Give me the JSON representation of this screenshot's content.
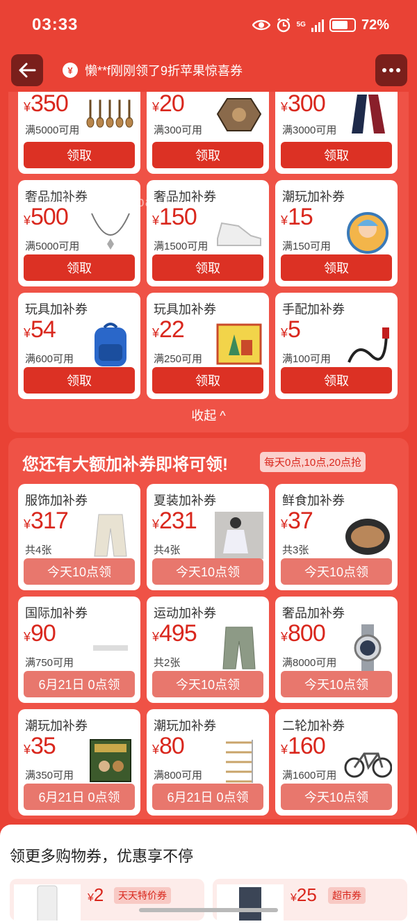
{
  "status": {
    "time": "03:33",
    "network": "5G",
    "battery": "72%",
    "battery_level": 0.72
  },
  "header": {
    "notice": "懒**f刚刚领了9折苹果惊喜券",
    "notice_icon": "¥"
  },
  "watermark": "新浪团-new.xianbao.fun",
  "claim_section": {
    "coupons": [
      {
        "label": "",
        "amount": "350",
        "condition": "满5000可用",
        "button": "领取",
        "icon": "guitars-image"
      },
      {
        "label": "",
        "amount": "20",
        "condition": "满300可用",
        "button": "领取",
        "icon": "concertina-image"
      },
      {
        "label": "",
        "amount": "300",
        "condition": "满3000可用",
        "button": "领取",
        "icon": "scarf-image"
      },
      {
        "label": "奢品加补券",
        "amount": "500",
        "condition": "满5000可用",
        "button": "领取",
        "icon": "necklace-image"
      },
      {
        "label": "奢品加补券",
        "amount": "150",
        "condition": "满1500可用",
        "button": "领取",
        "icon": "sneaker-image"
      },
      {
        "label": "潮玩加补券",
        "amount": "15",
        "condition": "满150可用",
        "button": "领取",
        "icon": "badge-image"
      },
      {
        "label": "玩具加补券",
        "amount": "54",
        "condition": "满600可用",
        "button": "领取",
        "icon": "backpack-image"
      },
      {
        "label": "玩具加补券",
        "amount": "22",
        "condition": "满250可用",
        "button": "领取",
        "icon": "puzzle-box-image"
      },
      {
        "label": "手配加补券",
        "amount": "5",
        "condition": "满100可用",
        "button": "领取",
        "icon": "cable-image"
      }
    ],
    "collapse_label": "收起 ^"
  },
  "upcoming_section": {
    "title": "您还有大额加补券即将可领!",
    "tag": "每天0点,10点,20点抢",
    "coupons": [
      {
        "label": "服饰加补券",
        "amount": "317",
        "condition": "共4张",
        "button": "今天10点领",
        "icon": "pants-image"
      },
      {
        "label": "夏装加补券",
        "amount": "231",
        "condition": "共4张",
        "button": "今天10点领",
        "icon": "dress-photo"
      },
      {
        "label": "鲜食加补券",
        "amount": "37",
        "condition": "共3张",
        "button": "今天10点领",
        "icon": "fish-dish-image"
      },
      {
        "label": "国际加补券",
        "amount": "90",
        "condition": "满750可用",
        "button": "6月21日 0点领",
        "icon": "sheet-pan-image"
      },
      {
        "label": "运动加补券",
        "amount": "495",
        "condition": "共2张",
        "button": "今天10点领",
        "icon": "trousers-image"
      },
      {
        "label": "奢品加补券",
        "amount": "800",
        "condition": "满8000可用",
        "button": "今天10点领",
        "icon": "watch-image"
      },
      {
        "label": "潮玩加补券",
        "amount": "35",
        "condition": "满350可用",
        "button": "6月21日 0点领",
        "icon": "board-game-image"
      },
      {
        "label": "潮玩加补券",
        "amount": "80",
        "condition": "满800可用",
        "button": "6月21日 0点领",
        "icon": "shelf-image"
      },
      {
        "label": "二轮加补券",
        "amount": "160",
        "condition": "满1600可用",
        "button": "今天10点领",
        "icon": "bicycle-image"
      }
    ]
  },
  "more_section": {
    "title": "领更多购物券，优惠享不停",
    "cards": [
      {
        "amount": "2",
        "tag": "天天特价券"
      },
      {
        "amount": "25",
        "tag": "超市券"
      }
    ]
  },
  "colors": {
    "background": "#e94235",
    "panel": "#ef5246",
    "claim_button": "#dc3124",
    "later_button": "#e8776d",
    "amount": "#d9271d"
  }
}
